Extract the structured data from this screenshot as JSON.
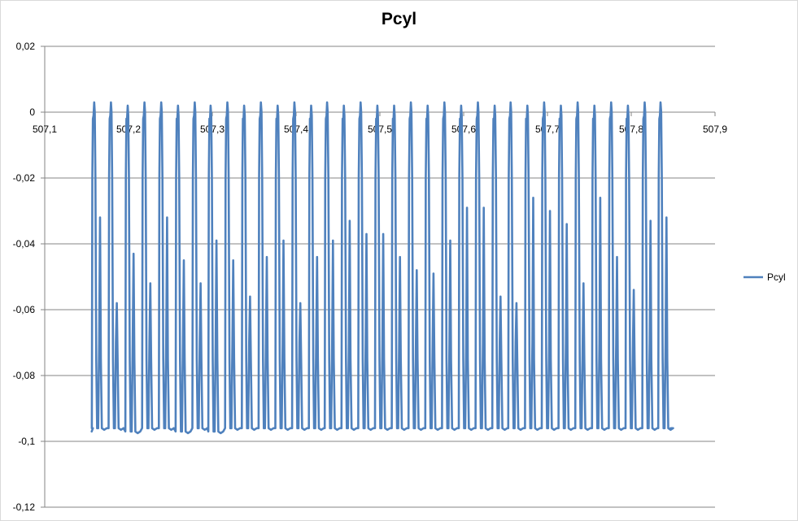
{
  "chart_data": {
    "type": "line",
    "title": "Pcyl",
    "xlabel": "",
    "ylabel": "",
    "xlim": [
      507.1,
      507.9
    ],
    "ylim": [
      -0.12,
      0.02
    ],
    "x_ticks": [
      507.1,
      507.2,
      507.3,
      507.4,
      507.5,
      507.6,
      507.7,
      507.8,
      507.9
    ],
    "x_tick_labels": [
      "507,1",
      "507,2",
      "507,3",
      "507,4",
      "507,5",
      "507,6",
      "507,7",
      "507,8",
      "507,9"
    ],
    "y_ticks": [
      0.02,
      0,
      -0.02,
      -0.04,
      -0.06,
      -0.08,
      -0.1,
      -0.12
    ],
    "y_tick_labels": [
      "0,02",
      "0",
      "-0,02",
      "-0,04",
      "-0,06",
      "-0,08",
      "-0,1",
      "-0,12"
    ],
    "grid": true,
    "x_axis_crosses_at": 0,
    "legend_position": "right",
    "series": [
      {
        "name": "Pcyl",
        "color": "#4f81bd",
        "x_range": [
          507.156,
          507.849
        ],
        "cycle_peaks_x": [
          507.159,
          507.179,
          507.199,
          507.219,
          507.239,
          507.259,
          507.279,
          507.298,
          507.318,
          507.338,
          507.358,
          507.378,
          507.398,
          507.418,
          507.437,
          507.457,
          507.477,
          507.497,
          507.517,
          507.537,
          507.557,
          507.577,
          507.597,
          507.617,
          507.637,
          507.656,
          507.676,
          507.696,
          507.716,
          507.736,
          507.756,
          507.776,
          507.796,
          507.816,
          507.835
        ],
        "peak_values": [
          0.003,
          0.003,
          0.002,
          0.003,
          0.003,
          0.002,
          0.003,
          0.002,
          0.003,
          0.002,
          0.003,
          0.002,
          0.003,
          0.002,
          0.003,
          0.002,
          0.003,
          0.002,
          0.002,
          0.003,
          0.002,
          0.003,
          0.002,
          0.003,
          0.002,
          0.003,
          0.002,
          0.003,
          0.002,
          0.003,
          0.002,
          0.003,
          0.002,
          0.003,
          0.003
        ],
        "trough_values": [
          -0.096,
          -0.096,
          -0.097,
          -0.096,
          -0.096,
          -0.097,
          -0.096,
          -0.097,
          -0.096,
          -0.096,
          -0.096,
          -0.096,
          -0.096,
          -0.096,
          -0.096,
          -0.096,
          -0.096,
          -0.096,
          -0.096,
          -0.096,
          -0.096,
          -0.096,
          -0.096,
          -0.096,
          -0.096,
          -0.096,
          -0.096,
          -0.096,
          -0.096,
          -0.096,
          -0.096,
          -0.096,
          -0.096,
          -0.096,
          -0.096
        ],
        "secondary_spike_values": [
          -0.032,
          -0.058,
          -0.043,
          -0.052,
          -0.032,
          -0.045,
          -0.052,
          -0.039,
          -0.045,
          -0.056,
          -0.044,
          -0.039,
          -0.058,
          -0.044,
          -0.039,
          -0.033,
          -0.037,
          -0.037,
          -0.044,
          -0.048,
          -0.049,
          -0.039,
          -0.029,
          -0.029,
          -0.056,
          -0.058,
          -0.026,
          -0.03,
          -0.034,
          -0.052,
          -0.026,
          -0.044,
          -0.054,
          -0.033,
          -0.032
        ],
        "start_value": -0.097,
        "end_value": -0.096
      }
    ]
  }
}
